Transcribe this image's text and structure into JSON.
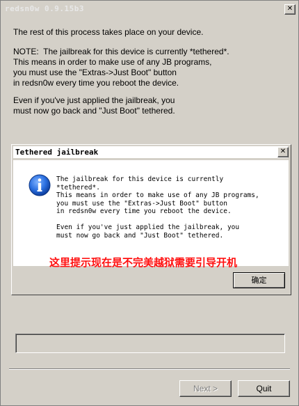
{
  "window": {
    "title": "redsn0w 0.9.15b3",
    "close_glyph": "✕"
  },
  "main": {
    "line1": "The rest of this process takes place on your device.",
    "note": "NOTE:  The jailbreak for this device is currently *tethered*.\nThis means in order to make use of any JB programs,\nyou must use the \"Extras->Just Boot\" button\nin redsn0w every time you reboot the device.",
    "even": "Even if you've just applied the jailbreak, you\nmust now go back and \"Just Boot\" tethered."
  },
  "dialog": {
    "title": "Tethered jailbreak",
    "close_glyph": "✕",
    "icon": "info-icon",
    "message": "The jailbreak for this device is currently\n*tethered*.\nThis means in order to make use of any JB programs,\nyou must use the \"Extras->Just Boot\" button\nin redsn0w every time you reboot the device.\n\nEven if you've just applied the jailbreak, you\nmust now go back and \"Just Boot\" tethered.",
    "annotation": "这里提示现在是不完美越狱需要引导开机",
    "ok_label": "确定"
  },
  "progress": {
    "value": 0
  },
  "footer": {
    "next_label": "Next >",
    "quit_label": "Quit"
  },
  "colors": {
    "annotation": "#ff1010",
    "icon_blue": "#1b5fd0",
    "background": "#d4d0c8"
  }
}
